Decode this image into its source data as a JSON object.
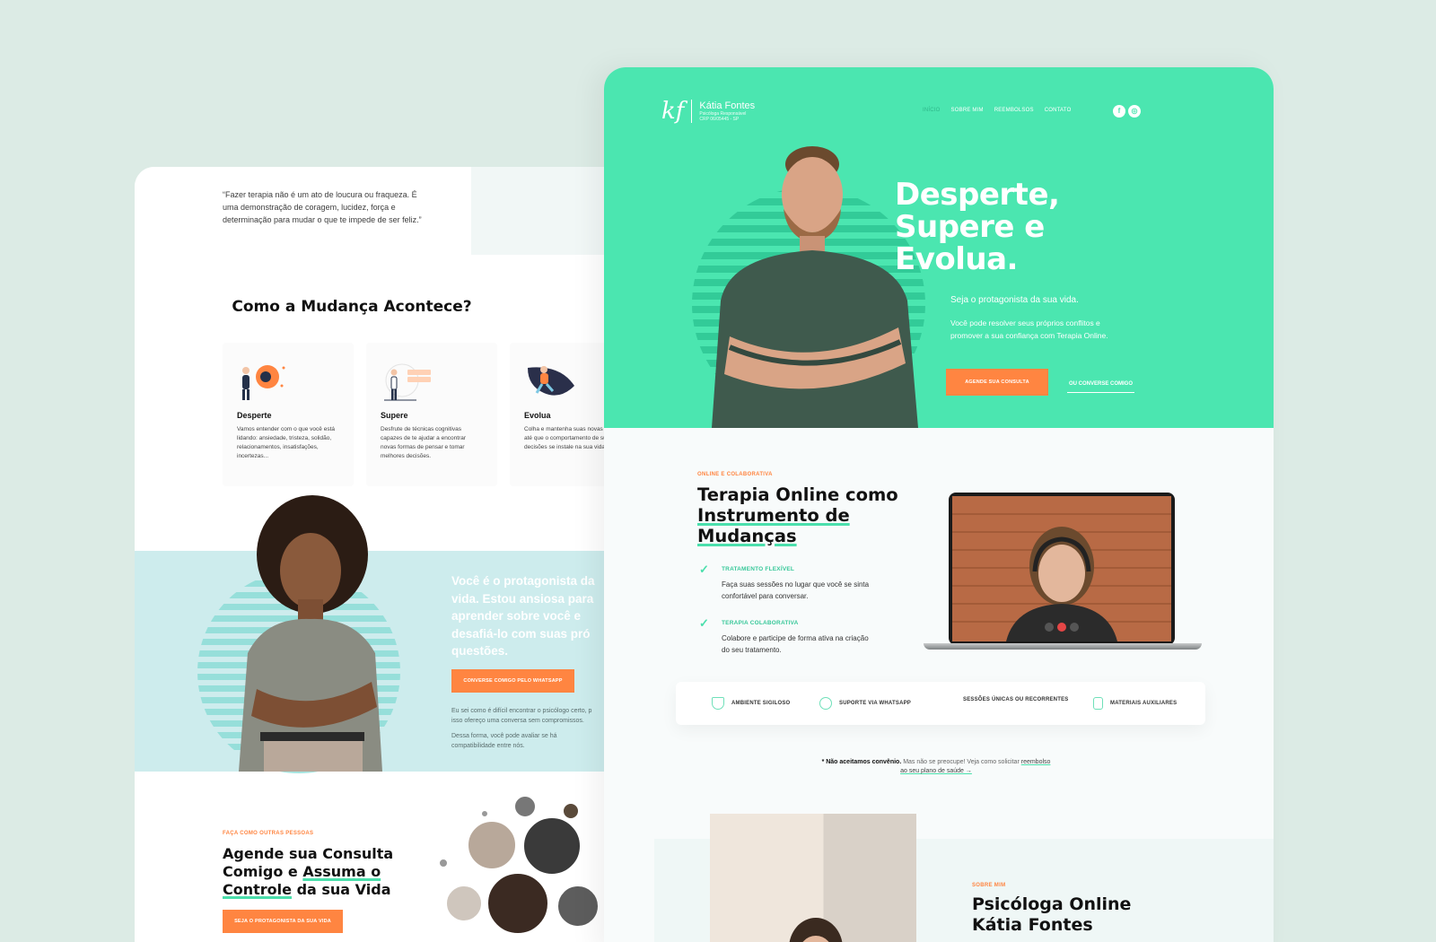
{
  "left": {
    "quote": "“Fazer terapia não é um ato de loucura ou fraqueza. É uma demonstração de coragem, lucidez, força e determinação para mudar o que te impede de ser feliz.”",
    "how_title": "Como a Mudança Acontece?",
    "steps": [
      {
        "title": "Desperte",
        "text": "Vamos entender com o que você está lidando: ansiedade, tristeza, solidão, relacionamentos, insatisfações, incertezas..."
      },
      {
        "title": "Supere",
        "text": "Desfrute de técnicas cognitivas capazes de te ajudar a encontrar novas formas de pensar e tomar melhores decisões."
      },
      {
        "title": "Evolua",
        "text": "Colha e mantenha suas novas visões até que o comportamento de suas decisões se instale na sua vida."
      }
    ],
    "band_headline_lines": [
      "Você é o protagonista da",
      "vida. Estou ansiosa para",
      "aprender sobre você e",
      "desafiá-lo com suas pró",
      "questões."
    ],
    "whatsapp_button": "CONVERSE COMIGO PELO WHATSAPP",
    "band_text_1_lines": [
      "Eu sei como é difícil encontrar o psicólogo certo, p",
      "isso ofereço uma conversa sem compromissos."
    ],
    "band_text_2_lines": [
      "Dessa forma, você pode avaliar se há",
      "compatibilidade entre nós."
    ],
    "agende_eyebrow": "FAÇA COMO OUTRAS PESSOAS",
    "agende_title_parts": [
      "Agende sua Consulta Comigo e ",
      "Assuma o Controle",
      " da sua Vida"
    ],
    "agende_button": "SEJA O PROTAGONISTA DA SUA VIDA"
  },
  "right": {
    "logo_mark": "kf",
    "logo_name": "Kátia Fontes",
    "logo_sub_1": "Psicóloga Responsável",
    "logo_sub_2": "CRP 06/05445 - SP",
    "nav": [
      "INÍCIO",
      "SOBRE MIM",
      "REEMBOLSOS",
      "CONTATO"
    ],
    "social": [
      "f",
      "◎"
    ],
    "hero_title_lines": [
      "Desperte,",
      "Supere e",
      "Evolua."
    ],
    "hero_sub": "Seja o protagonista da sua vida.",
    "hero_text": "Você pode resolver seus próprios conflitos e promover a sua confiança com Terapia Online.",
    "hero_button": "AGENDE SUA CONSULTA",
    "hero_link": "OU CONVERSE COMIGO",
    "terapia_eyebrow": "ONLINE E COLABORATIVA",
    "terapia_title_parts": [
      "Terapia Online como ",
      "Instrumento de Mudanças"
    ],
    "features": [
      {
        "title": "TRATAMENTO FLEXÍVEL",
        "text": "Faça suas sessões no lugar que você se sinta confortável para conversar."
      },
      {
        "title": "TERAPIA COLABORATIVA",
        "text": "Colabore e participe de forma ativa na criação do seu tratamento."
      }
    ],
    "feature_bar": [
      "AMBIENTE SIGILOSO",
      "SUPORTE VIA WHATSAPP",
      "SESSÕES ÚNICAS OU RECORRENTES",
      "MATERIAIS AUXILIARES"
    ],
    "note_bold": "* Não aceitamos convênio.",
    "note_text": " Mas não se preocupe! Veja como solicitar ",
    "note_link": "reembolso ao seu plano de saúde →",
    "sobre_eyebrow": "SOBRE MIM",
    "sobre_title_lines": [
      "Psicóloga Online",
      "Kátia Fontes"
    ]
  },
  "colors": {
    "accent_green": "#4be6b0",
    "accent_orange": "#ff8541",
    "background": "#dcebe5"
  }
}
